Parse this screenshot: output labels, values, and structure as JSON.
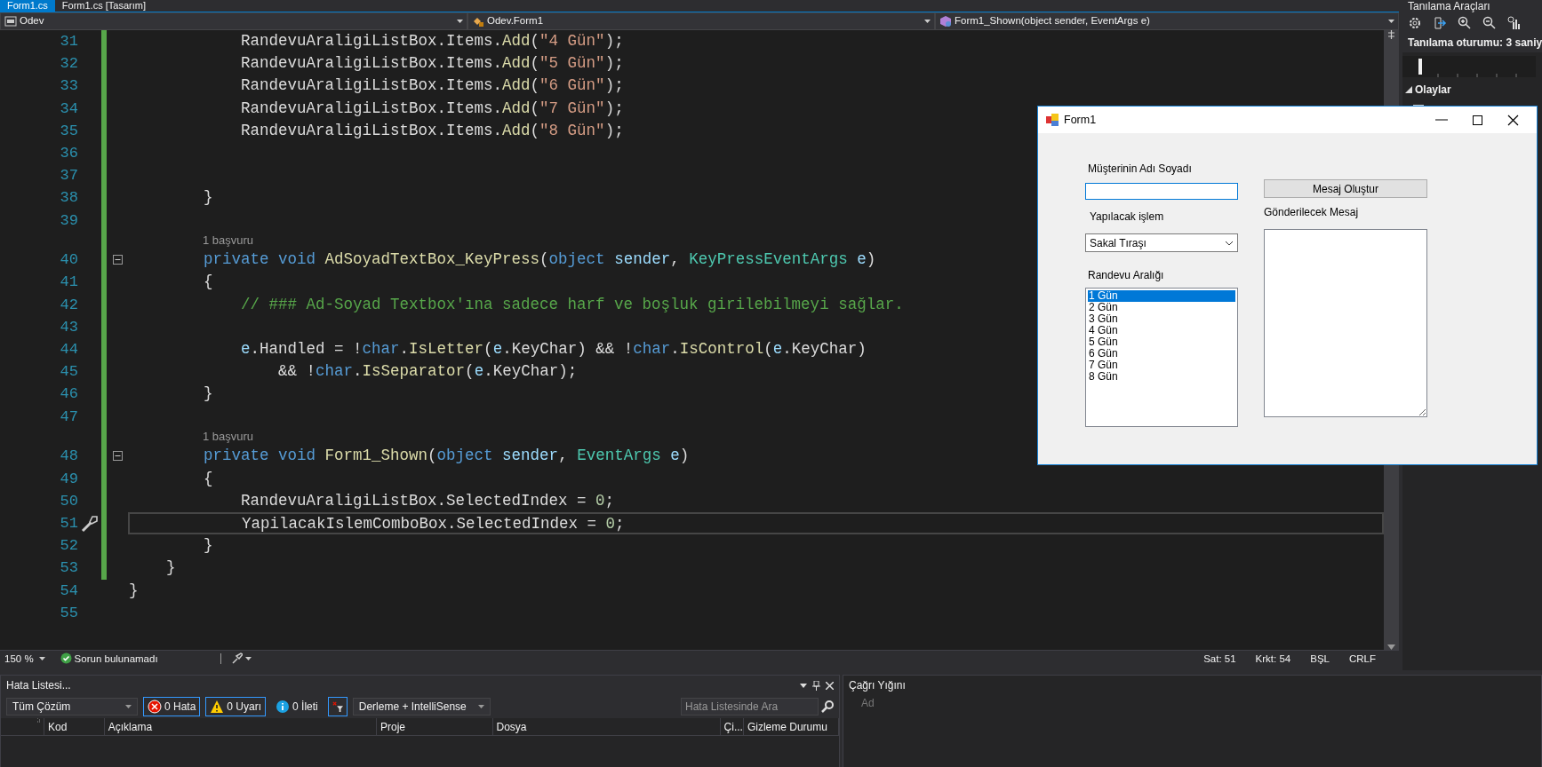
{
  "editor_tabs": [
    {
      "label": "Form1.cs",
      "selected": true
    },
    {
      "label": "Form1.cs [Tasarım]",
      "selected": false
    }
  ],
  "navigation_bar": {
    "project": "Odev",
    "type": "Odev.Form1",
    "member": "Form1_Shown(object sender, EventArgs e)"
  },
  "code_lines": [
    {
      "kind": "code",
      "number": "31",
      "modified": true,
      "current": false,
      "tokens": [
        {
          "kind": "plain",
          "text": "            RandevuAraligiListBox.Items."
        },
        {
          "kind": "method",
          "text": "Add"
        },
        {
          "kind": "plain",
          "text": "("
        },
        {
          "kind": "string",
          "text": "\"4 Gün\""
        },
        {
          "kind": "plain",
          "text": ");"
        }
      ]
    },
    {
      "kind": "code",
      "number": "32",
      "modified": true,
      "current": false,
      "tokens": [
        {
          "kind": "plain",
          "text": "            RandevuAraligiListBox.Items."
        },
        {
          "kind": "method",
          "text": "Add"
        },
        {
          "kind": "plain",
          "text": "("
        },
        {
          "kind": "string",
          "text": "\"5 Gün\""
        },
        {
          "kind": "plain",
          "text": ");"
        }
      ]
    },
    {
      "kind": "code",
      "number": "33",
      "modified": true,
      "current": false,
      "tokens": [
        {
          "kind": "plain",
          "text": "            RandevuAraligiListBox.Items."
        },
        {
          "kind": "method",
          "text": "Add"
        },
        {
          "kind": "plain",
          "text": "("
        },
        {
          "kind": "string",
          "text": "\"6 Gün\""
        },
        {
          "kind": "plain",
          "text": ");"
        }
      ]
    },
    {
      "kind": "code",
      "number": "34",
      "modified": true,
      "current": false,
      "tokens": [
        {
          "kind": "plain",
          "text": "            RandevuAraligiListBox.Items."
        },
        {
          "kind": "method",
          "text": "Add"
        },
        {
          "kind": "plain",
          "text": "("
        },
        {
          "kind": "string",
          "text": "\"7 Gün\""
        },
        {
          "kind": "plain",
          "text": ");"
        }
      ]
    },
    {
      "kind": "code",
      "number": "35",
      "modified": true,
      "current": false,
      "tokens": [
        {
          "kind": "plain",
          "text": "            RandevuAraligiListBox.Items."
        },
        {
          "kind": "method",
          "text": "Add"
        },
        {
          "kind": "plain",
          "text": "("
        },
        {
          "kind": "string",
          "text": "\"8 Gün\""
        },
        {
          "kind": "plain",
          "text": ");"
        }
      ]
    },
    {
      "kind": "code",
      "number": "36",
      "modified": true,
      "current": false
    },
    {
      "kind": "code",
      "number": "37",
      "modified": true,
      "current": false
    },
    {
      "kind": "code",
      "number": "38",
      "modified": true,
      "current": false,
      "tokens": [
        {
          "kind": "plain",
          "text": "        }"
        }
      ]
    },
    {
      "kind": "code",
      "number": "39",
      "modified": true,
      "current": false
    },
    {
      "kind": "codelens",
      "text": "1 başvuru",
      "modified": true
    },
    {
      "kind": "code",
      "number": "40",
      "modified": true,
      "current": false,
      "fold_expanded": true,
      "tokens": [
        {
          "kind": "keyword",
          "text": "        private void "
        },
        {
          "kind": "method",
          "text": "AdSoyadTextBox_KeyPress"
        },
        {
          "kind": "plain",
          "text": "("
        },
        {
          "kind": "keyword",
          "text": "object "
        },
        {
          "kind": "param",
          "text": "sender"
        },
        {
          "kind": "plain",
          "text": ", "
        },
        {
          "kind": "type",
          "text": "KeyPressEventArgs "
        },
        {
          "kind": "param",
          "text": "e"
        },
        {
          "kind": "plain",
          "text": ")"
        }
      ]
    },
    {
      "kind": "code",
      "number": "41",
      "modified": true,
      "current": false,
      "tokens": [
        {
          "kind": "plain",
          "text": "        {"
        }
      ]
    },
    {
      "kind": "code",
      "number": "42",
      "modified": true,
      "current": false,
      "tokens": [
        {
          "kind": "comment",
          "text": "            // ### Ad-Soyad Textbox'ına sadece harf ve boşluk girilebilmeyi sağlar."
        }
      ]
    },
    {
      "kind": "code",
      "number": "43",
      "modified": true,
      "current": false
    },
    {
      "kind": "code",
      "number": "44",
      "modified": true,
      "current": false,
      "tokens": [
        {
          "kind": "param",
          "text": "            e"
        },
        {
          "kind": "plain",
          "text": ".Handled = !"
        },
        {
          "kind": "keyword",
          "text": "char"
        },
        {
          "kind": "plain",
          "text": "."
        },
        {
          "kind": "method",
          "text": "IsLetter"
        },
        {
          "kind": "plain",
          "text": "("
        },
        {
          "kind": "param",
          "text": "e"
        },
        {
          "kind": "plain",
          "text": ".KeyChar) && !"
        },
        {
          "kind": "keyword",
          "text": "char"
        },
        {
          "kind": "plain",
          "text": "."
        },
        {
          "kind": "method",
          "text": "IsControl"
        },
        {
          "kind": "plain",
          "text": "("
        },
        {
          "kind": "param",
          "text": "e"
        },
        {
          "kind": "plain",
          "text": ".KeyChar)"
        }
      ]
    },
    {
      "kind": "code",
      "number": "45",
      "modified": true,
      "current": false,
      "tokens": [
        {
          "kind": "plain",
          "text": "                && !"
        },
        {
          "kind": "keyword",
          "text": "char"
        },
        {
          "kind": "plain",
          "text": "."
        },
        {
          "kind": "method",
          "text": "IsSeparator"
        },
        {
          "kind": "plain",
          "text": "("
        },
        {
          "kind": "param",
          "text": "e"
        },
        {
          "kind": "plain",
          "text": ".KeyChar);"
        }
      ]
    },
    {
      "kind": "code",
      "number": "46",
      "modified": true,
      "current": false,
      "tokens": [
        {
          "kind": "plain",
          "text": "        }"
        }
      ]
    },
    {
      "kind": "code",
      "number": "47",
      "modified": true,
      "current": false
    },
    {
      "kind": "codelens",
      "text": "1 başvuru",
      "modified": true
    },
    {
      "kind": "code",
      "number": "48",
      "modified": true,
      "current": false,
      "fold_expanded": true,
      "tokens": [
        {
          "kind": "keyword",
          "text": "        private void "
        },
        {
          "kind": "method",
          "text": "Form1_Shown"
        },
        {
          "kind": "plain",
          "text": "("
        },
        {
          "kind": "keyword",
          "text": "object "
        },
        {
          "kind": "param",
          "text": "sender"
        },
        {
          "kind": "plain",
          "text": ", "
        },
        {
          "kind": "type",
          "text": "EventArgs "
        },
        {
          "kind": "param",
          "text": "e"
        },
        {
          "kind": "plain",
          "text": ")"
        }
      ]
    },
    {
      "kind": "code",
      "number": "49",
      "modified": true,
      "current": false,
      "tokens": [
        {
          "kind": "plain",
          "text": "        {"
        }
      ]
    },
    {
      "kind": "code",
      "number": "50",
      "modified": true,
      "current": false,
      "tokens": [
        {
          "kind": "plain",
          "text": "            RandevuAraligiListBox.SelectedIndex = "
        },
        {
          "kind": "number",
          "text": "0"
        },
        {
          "kind": "plain",
          "text": ";"
        }
      ]
    },
    {
      "kind": "code",
      "number": "51",
      "modified": true,
      "current": true,
      "tokens": [
        {
          "kind": "plain",
          "text": "            YapilacakIslemComboBox.SelectedIndex = "
        },
        {
          "kind": "number",
          "text": "0"
        },
        {
          "kind": "plain",
          "text": ";"
        }
      ]
    },
    {
      "kind": "code",
      "number": "52",
      "modified": true,
      "current": false,
      "tokens": [
        {
          "kind": "plain",
          "text": "        }"
        }
      ]
    },
    {
      "kind": "code",
      "number": "53",
      "modified": true,
      "current": false,
      "tokens": [
        {
          "kind": "plain",
          "text": "    }"
        }
      ]
    },
    {
      "kind": "code",
      "number": "54",
      "modified": false,
      "current": false,
      "tokens": [
        {
          "kind": "plain",
          "text": "}"
        }
      ]
    },
    {
      "kind": "code",
      "number": "55",
      "modified": false,
      "current": false
    }
  ],
  "status_bar": {
    "zoom": "150 %",
    "issues": "Sorun bulunamadı",
    "line": "Sat: 51",
    "column": "Krkt: 54",
    "mode": "BŞL",
    "line_endings": "CRLF"
  },
  "diagnostics_panel": {
    "title": "Tanılama Araçları",
    "session": "Tanılama oturumu: 3 saniy",
    "events_section": {
      "label": "Olaylar",
      "expanded": true
    }
  },
  "error_list": {
    "title": "Hata Listesi...",
    "scope": "Tüm Çözüm",
    "filters": [
      {
        "kind": "error",
        "label": "0 Hata",
        "selected": true
      },
      {
        "kind": "warning",
        "label": "0 Uyarı",
        "selected": true
      },
      {
        "kind": "info",
        "label": "0 İleti",
        "selected": false
      }
    ],
    "filter_toggle": {
      "selected": true
    },
    "source": "Derleme + IntelliSense",
    "search_placeholder": "Hata Listesinde Ara",
    "columns": [
      "Kod",
      "Açıklama",
      "Proje",
      "Dosya",
      "Çi...",
      "Gizleme Durumu"
    ]
  },
  "call_stack": {
    "title": "Çağrı Yığını",
    "columns": [
      "Ad"
    ]
  },
  "form_window": {
    "title": "Form1",
    "name_label": "Müşterinin Adı Soyadı",
    "name_field": {
      "focused": true
    },
    "create_button": "Mesaj Oluştur",
    "service_label": "Yapılacak işlem",
    "service_value": "Sakal Tıraşı",
    "message_label": "Gönderilecek Mesaj",
    "interval_label": "Randevu Aralığı",
    "interval_items": [
      {
        "label": "1 Gün",
        "selected": true
      },
      {
        "label": "2 Gün",
        "selected": false
      },
      {
        "label": "3 Gün",
        "selected": false
      },
      {
        "label": "4 Gün",
        "selected": false
      },
      {
        "label": "5 Gün",
        "selected": false
      },
      {
        "label": "6 Gün",
        "selected": false
      },
      {
        "label": "7 Gün",
        "selected": false
      },
      {
        "label": "8 Gün",
        "selected": false
      }
    ]
  }
}
